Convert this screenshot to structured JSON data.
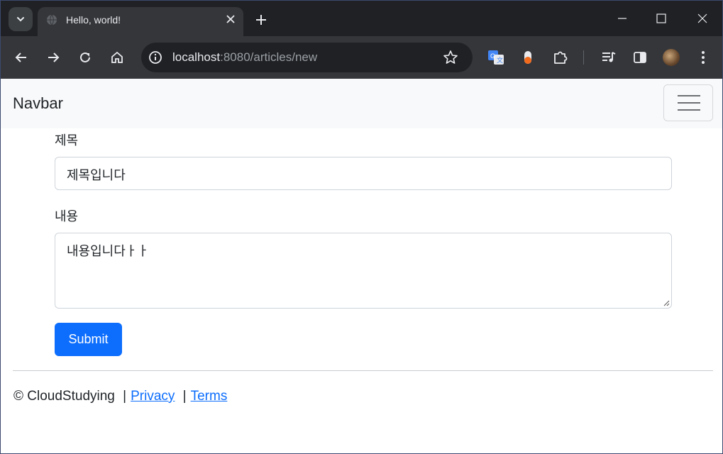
{
  "browser": {
    "tab_title": "Hello, world!",
    "url_host": "localhost",
    "url_rest": ":8080/articles/new"
  },
  "navbar": {
    "brand": "Navbar"
  },
  "form": {
    "title_label": "제목",
    "title_value": "제목입니다",
    "content_label": "내용",
    "content_value": "내용입니다ㅏㅏ",
    "submit_label": "Submit"
  },
  "footer": {
    "copyright": "© CloudStudying",
    "separator": "|",
    "privacy": "Privacy",
    "terms": "Terms"
  },
  "colors": {
    "primary": "#0d6efd",
    "navbar_bg": "#f8f9fa",
    "chrome_dark": "#202124",
    "chrome_toolbar": "#35363a"
  },
  "icons": [
    "tab-search-icon",
    "globe-icon",
    "close-icon",
    "plus-icon",
    "minimize-icon",
    "maximize-icon",
    "back-icon",
    "forward-icon",
    "reload-icon",
    "home-icon",
    "info-icon",
    "star-icon",
    "translate-icon",
    "extension-icon",
    "puzzle-icon",
    "media-icon",
    "side-panel-icon",
    "kebab-menu-icon",
    "hamburger-icon"
  ]
}
